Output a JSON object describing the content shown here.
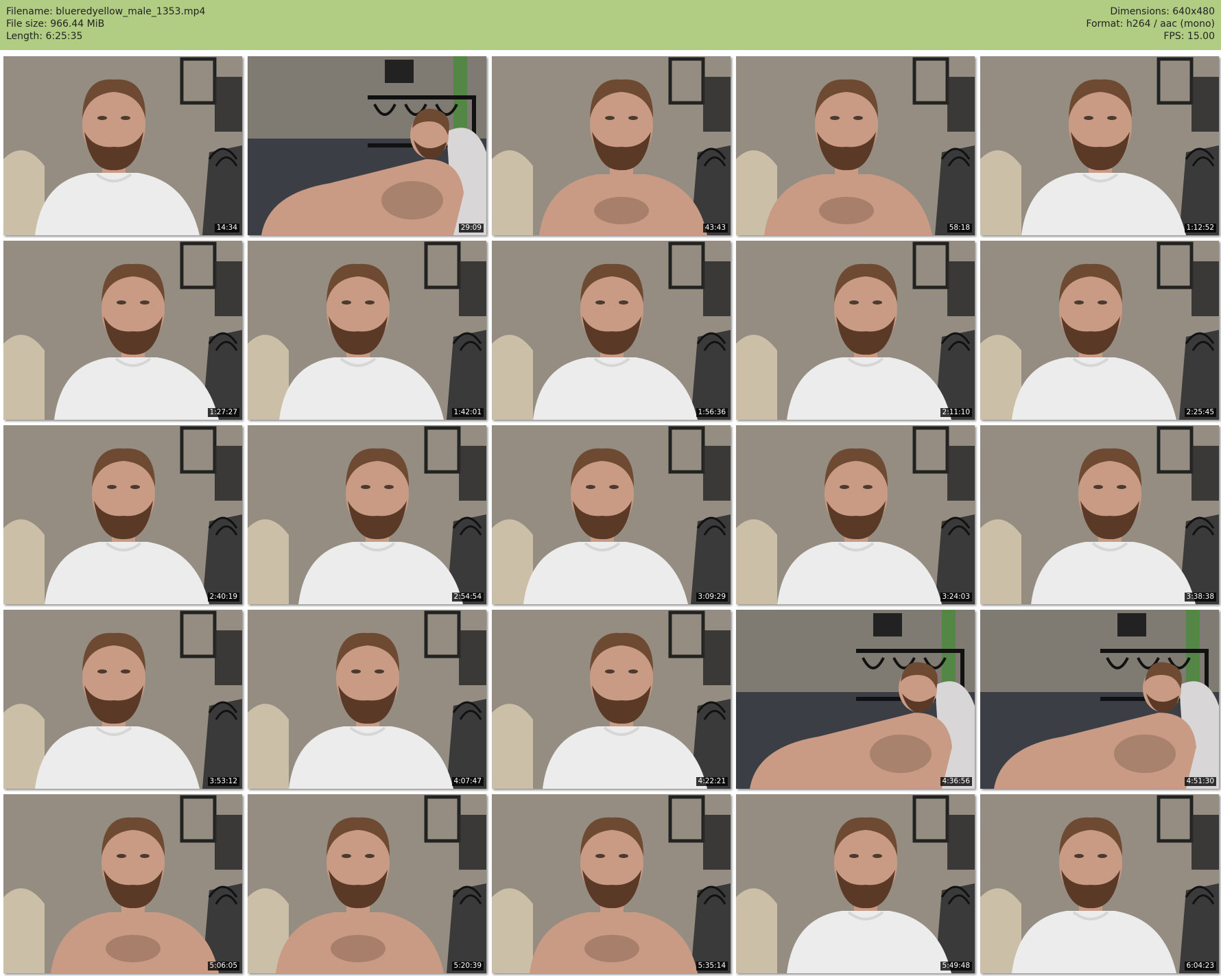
{
  "header": {
    "left": {
      "filename_label": "Filename: blueredyellow_male_1353.mp4",
      "filesize_label": "File size: 966.44 MiB",
      "length_label": "Length: 6:25:35"
    },
    "right": {
      "dimensions_label": "Dimensions: 640x480",
      "format_label": "Format: h264 / aac (mono)",
      "fps_label": "FPS: 15.00"
    }
  },
  "thumbnails": [
    {
      "timestamp": "14:34",
      "scene": "portrait-shirt"
    },
    {
      "timestamp": "29:09",
      "scene": "reclined"
    },
    {
      "timestamp": "43:43",
      "scene": "portrait-shirtless"
    },
    {
      "timestamp": "58:18",
      "scene": "portrait-shirtless"
    },
    {
      "timestamp": "1:12:52",
      "scene": "portrait-shirt"
    },
    {
      "timestamp": "1:27:27",
      "scene": "portrait-shirt"
    },
    {
      "timestamp": "1:42:01",
      "scene": "portrait-shirt"
    },
    {
      "timestamp": "1:56:36",
      "scene": "portrait-shirt"
    },
    {
      "timestamp": "2:11:10",
      "scene": "portrait-shirt"
    },
    {
      "timestamp": "2:25:45",
      "scene": "portrait-shirt"
    },
    {
      "timestamp": "2:40:19",
      "scene": "portrait-shirt"
    },
    {
      "timestamp": "2:54:54",
      "scene": "portrait-shirt"
    },
    {
      "timestamp": "3:09:29",
      "scene": "portrait-shirt"
    },
    {
      "timestamp": "3:24:03",
      "scene": "portrait-shirt"
    },
    {
      "timestamp": "3:38:38",
      "scene": "portrait-shirt"
    },
    {
      "timestamp": "3:53:12",
      "scene": "portrait-shirt"
    },
    {
      "timestamp": "4:07:47",
      "scene": "portrait-shirt"
    },
    {
      "timestamp": "4:22:21",
      "scene": "portrait-shirt"
    },
    {
      "timestamp": "4:36:56",
      "scene": "reclined"
    },
    {
      "timestamp": "4:51:30",
      "scene": "reclined"
    },
    {
      "timestamp": "5:06:05",
      "scene": "portrait-shirtless"
    },
    {
      "timestamp": "5:20:39",
      "scene": "portrait-shirtless"
    },
    {
      "timestamp": "5:35:14",
      "scene": "portrait-shirtless"
    },
    {
      "timestamp": "5:49:48",
      "scene": "portrait-shirt"
    },
    {
      "timestamp": "6:04:23",
      "scene": "portrait-shirt"
    }
  ],
  "colors": {
    "header_bg": "#b1cd84",
    "wall": "#8d857a",
    "skin": "#c99a84",
    "hair": "#6e4a32",
    "shirt": "#ececec",
    "bed": "#3b3f45"
  }
}
